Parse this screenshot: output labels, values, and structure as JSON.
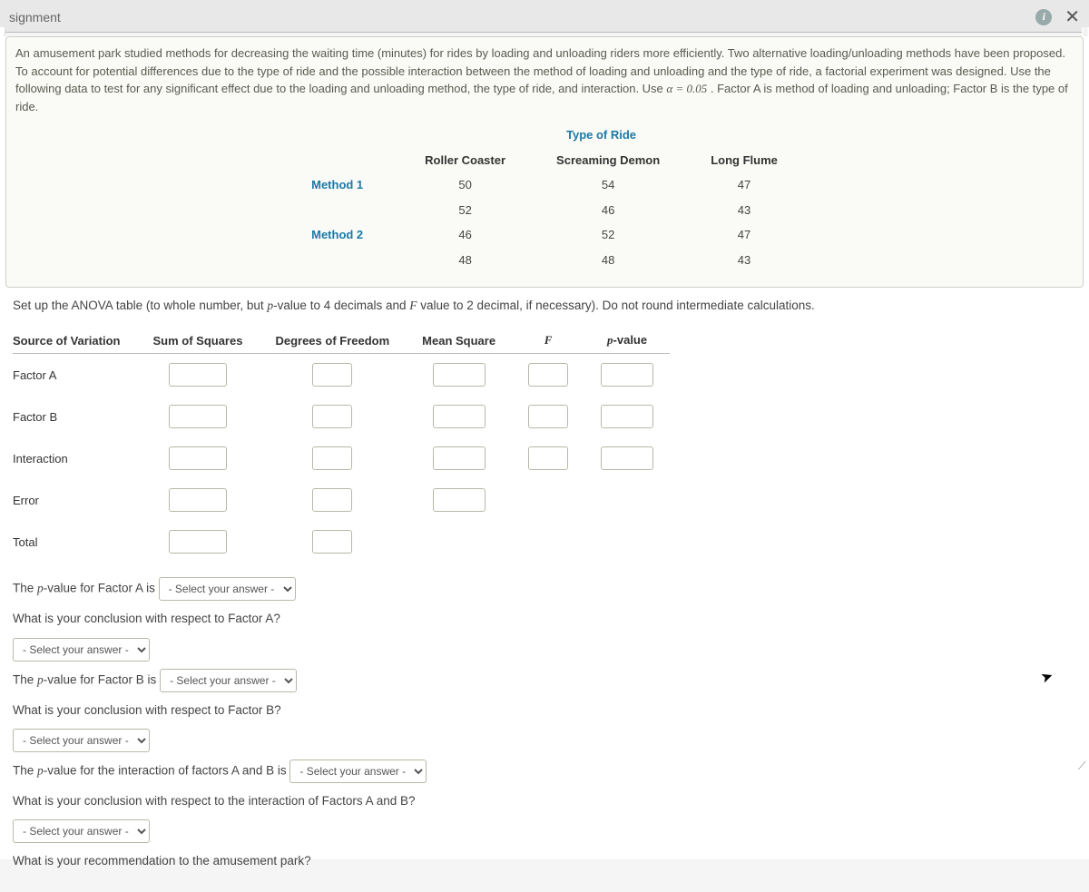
{
  "header": {
    "tab_label": "signment"
  },
  "question": {
    "text": "An amusement park studied methods for decreasing the waiting time (minutes) for rides by loading and unloading riders more efficiently. Two alternative loading/unloading methods have been proposed. To account for potential differences due to the type of ride and the possible interaction between the method of loading and unloading and the type of ride, a factorial experiment was designed. Use the following data to test for any significant effect due to the loading and unloading method, the type of ride, and interaction. Use ",
    "alpha_expr": "α = 0.05",
    "text_tail": ". Factor A is method of loading and unloading; Factor B is the type of ride."
  },
  "data_table": {
    "group_header": "Type of Ride",
    "cols": [
      "Roller Coaster",
      "Screaming Demon",
      "Long Flume"
    ],
    "rows": [
      {
        "label": "Method 1",
        "vals": [
          50,
          54,
          47
        ]
      },
      {
        "label": "",
        "vals": [
          52,
          46,
          43
        ]
      },
      {
        "label": "Method 2",
        "vals": [
          46,
          52,
          47
        ]
      },
      {
        "label": "",
        "vals": [
          48,
          48,
          43
        ]
      }
    ]
  },
  "anova": {
    "instruction_pre": "Set up the ANOVA table (to whole number, but ",
    "instruction_mid1": "-value to 4 decimals and ",
    "instruction_mid2": " value to 2 decimal, if necessary). Do not round intermediate calculations.",
    "headers": [
      "Source of Variation",
      "Sum of Squares",
      "Degrees of Freedom",
      "Mean Square",
      "F",
      "p-value"
    ],
    "p_sym": "p",
    "F_sym": "F",
    "rows": [
      "Factor A",
      "Factor B",
      "Interaction",
      "Error",
      "Total"
    ]
  },
  "followups": {
    "p_italic": "p",
    "fa_pvalue_pre": "The ",
    "fa_pvalue_mid": "-value for Factor A is ",
    "fa_conclusion_q": "What is your conclusion with respect to Factor A?",
    "fb_pvalue_pre": "The ",
    "fb_pvalue_mid": "-value for Factor B is ",
    "fb_conclusion_q": "What is your conclusion with respect to Factor B?",
    "int_pvalue_pre": "The ",
    "int_pvalue_mid": "-value for the interaction of factors A and B is ",
    "int_conclusion_q": "What is your conclusion with respect to the interaction of Factors A and B?",
    "recommend_q": "What is your recommendation to the amusement park?",
    "select_placeholder": "- Select your answer -"
  }
}
